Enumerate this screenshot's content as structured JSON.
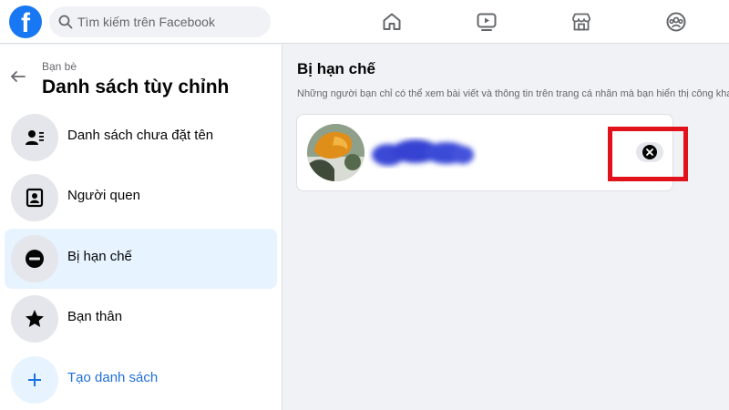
{
  "header": {
    "logo_letter": "f",
    "search": {
      "placeholder": "Tìm kiếm trên Facebook"
    },
    "nav": [
      "home-icon",
      "video-icon",
      "marketplace-icon",
      "groups-icon"
    ],
    "brand_color": "#1877f2"
  },
  "sidebar": {
    "breadcrumb": "Bạn bè",
    "title": "Danh sách tùy chỉnh",
    "items": [
      {
        "label": "Danh sách chưa đặt tên",
        "icon": "person-list-icon",
        "active": false
      },
      {
        "label": "Người quen",
        "icon": "acquaintance-card-icon",
        "active": false
      },
      {
        "label": "Bị hạn chế",
        "icon": "restricted-icon",
        "active": true
      },
      {
        "label": "Bạn thân",
        "icon": "star-icon",
        "active": false
      },
      {
        "label": "Tạo danh sách",
        "icon": "plus-icon",
        "active": false
      }
    ]
  },
  "main": {
    "title": "Bị hạn chế",
    "description": "Những người bạn chỉ có thể xem bài viết và thông tin trên trang cá nhân mà bạn hiển thị công khai",
    "members": [
      {
        "avatar": "profile-photo",
        "name_blurred": true,
        "remove_icon": "close-icon"
      }
    ]
  },
  "annotation_color": "#e1121a"
}
